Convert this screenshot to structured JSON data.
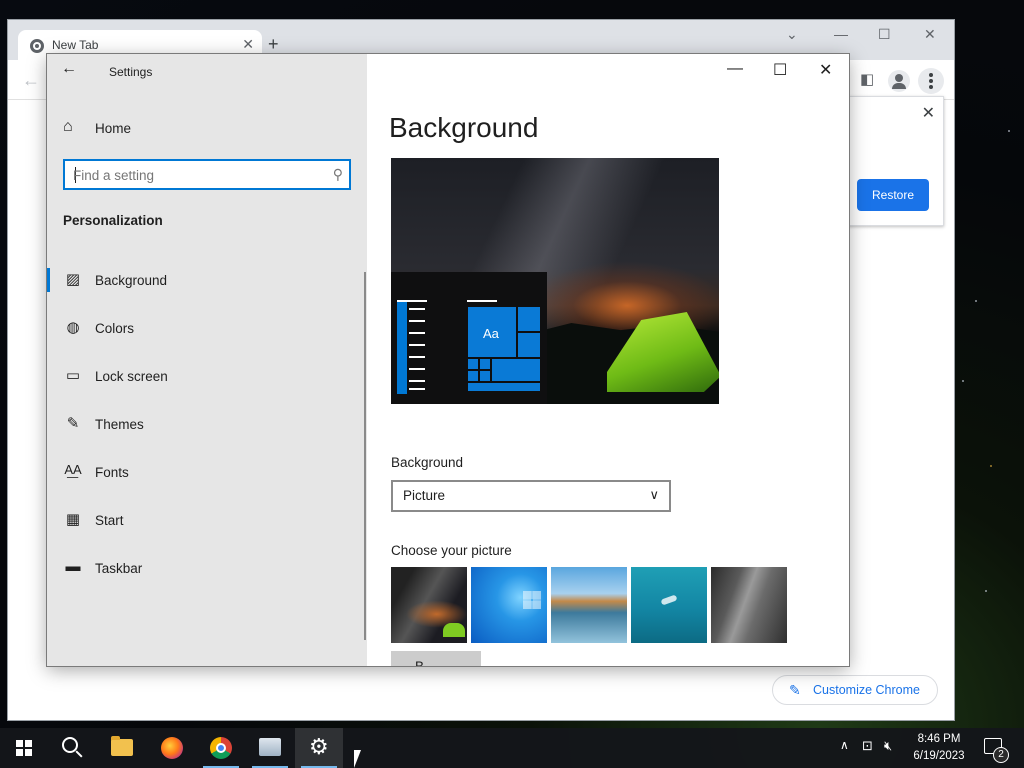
{
  "chrome": {
    "tab_title": "New Tab",
    "restore_label": "Restore",
    "customize_label": "Customize Chrome"
  },
  "settings": {
    "app_title": "Settings",
    "home_label": "Home",
    "search_placeholder": "Find a setting",
    "section_heading": "Personalization",
    "nav_items": [
      {
        "label": "Background",
        "icon": "picture-icon",
        "selected": true
      },
      {
        "label": "Colors",
        "icon": "palette-icon",
        "selected": false
      },
      {
        "label": "Lock screen",
        "icon": "lock-screen-icon",
        "selected": false
      },
      {
        "label": "Themes",
        "icon": "themes-icon",
        "selected": false
      },
      {
        "label": "Fonts",
        "icon": "fonts-icon",
        "selected": false
      },
      {
        "label": "Start",
        "icon": "start-icon",
        "selected": false
      },
      {
        "label": "Taskbar",
        "icon": "taskbar-icon",
        "selected": false
      }
    ],
    "page_title": "Background",
    "preview_tile_text": "Aa",
    "background_label": "Background",
    "background_value": "Picture",
    "choose_picture_label": "Choose your picture",
    "pictures": [
      "night-sky-tent",
      "windows-blue",
      "beach-rocks",
      "underwater-swimmer",
      "rock-cliff"
    ],
    "browse_label": "B"
  },
  "taskbar": {
    "apps": [
      "start",
      "search",
      "file-explorer",
      "firefox",
      "chrome",
      "photos",
      "settings"
    ],
    "active_app": "settings",
    "time": "8:46 PM",
    "date": "6/19/2023",
    "notification_count": "2"
  },
  "colors": {
    "accent": "#0078d4",
    "chrome_blue": "#1a73e8"
  }
}
